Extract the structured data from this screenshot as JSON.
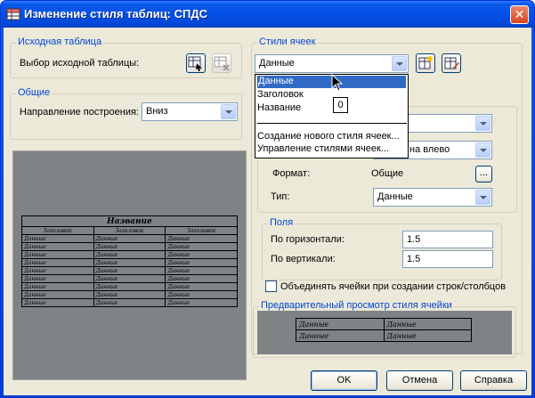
{
  "window": {
    "title": "Изменение стиля таблиц: СПДС",
    "close_label": "✕"
  },
  "source_table": {
    "group_title": "Исходная таблица",
    "label": "Выбор исходной таблицы:"
  },
  "general": {
    "group_title": "Общие",
    "direction_label": "Направление построения:",
    "direction_value": "Вниз"
  },
  "preview_table": {
    "title": "Название",
    "headers": [
      "Заголовок",
      "Заголовок",
      "Заголовок"
    ],
    "rows": [
      [
        "Данные",
        "Данные",
        "Данные"
      ],
      [
        "Данные",
        "Данные",
        "Данные"
      ],
      [
        "Данные",
        "Данные",
        "Данные"
      ],
      [
        "Данные",
        "Данные",
        "Данные"
      ],
      [
        "Данные",
        "Данные",
        "Данные"
      ],
      [
        "Данные",
        "Данные",
        "Данные"
      ],
      [
        "Данные",
        "Данные",
        "Данные"
      ],
      [
        "Данные",
        "Данные",
        "Данные"
      ],
      [
        "Данные",
        "Данные",
        "Данные"
      ]
    ]
  },
  "cell_styles": {
    "group_title": "Стили ячеек",
    "selected": "Данные",
    "dropdown_items": [
      "Данные",
      "Заголовок",
      "Название"
    ],
    "dropdown_actions": [
      "Создание нового стиля ячеек...",
      "Управление стилями ячеек..."
    ],
    "tooltip": "0"
  },
  "properties": {
    "alignment_partial": "на влево",
    "format_label": "Формат:",
    "format_value": "Общие",
    "format_button": "...",
    "type_label": "Тип:",
    "type_value": "Данные"
  },
  "margins": {
    "group_title": "Поля",
    "horizontal_label": "По горизонтали:",
    "horizontal_value": "1.5",
    "vertical_label": "По вертикали:",
    "vertical_value": "1.5"
  },
  "merge_label": "Объединять ячейки при создании строк/столбцов",
  "cell_preview": {
    "group_title": "Предварительный просмотр стиля ячейки",
    "cells": [
      [
        "Данные",
        "Данные"
      ],
      [
        "Данные",
        "Данные"
      ]
    ]
  },
  "buttons": {
    "ok": "OK",
    "cancel": "Отмена",
    "help": "Справка"
  }
}
